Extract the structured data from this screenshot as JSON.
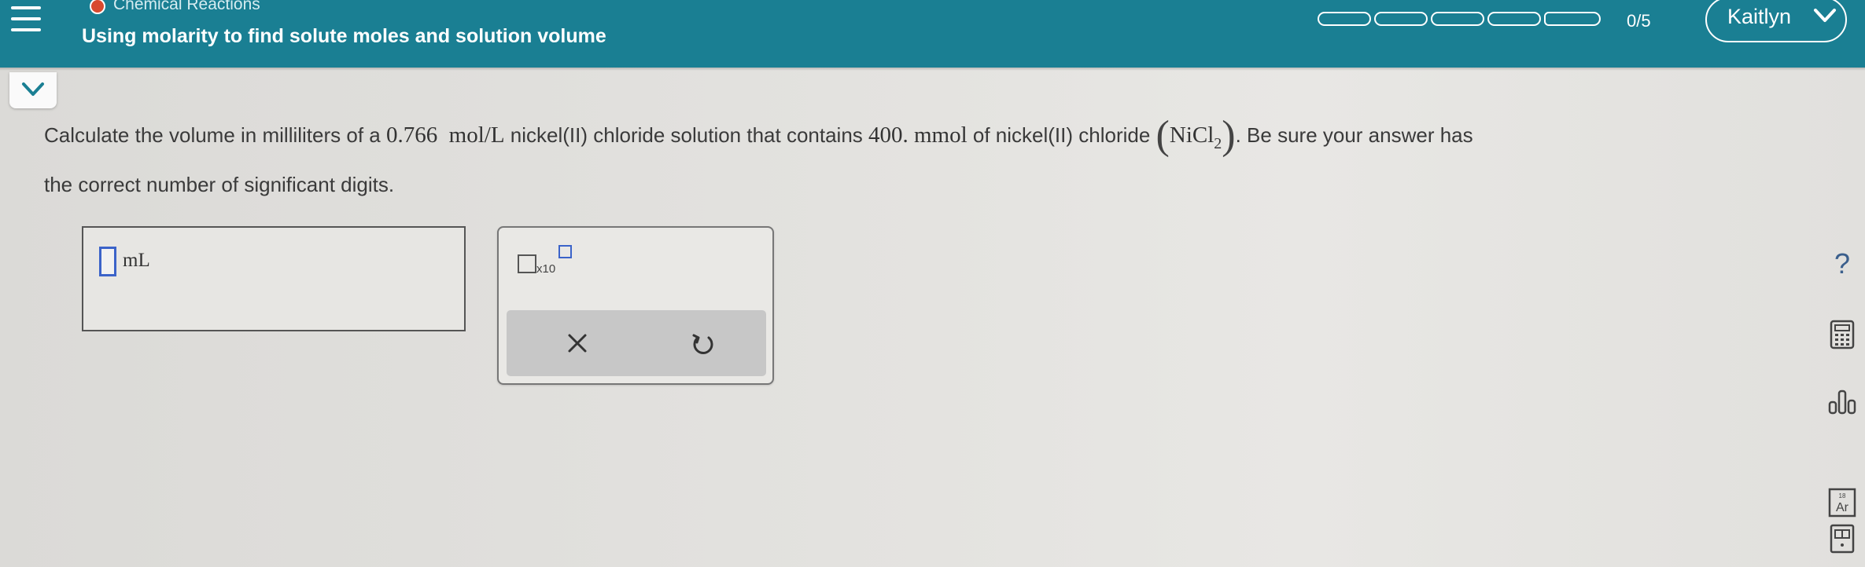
{
  "header": {
    "topic": "Chemical Reactions",
    "title": "Using molarity to find solute moles and solution volume",
    "progress": {
      "completed": 0,
      "total": 5,
      "label": "0/5"
    },
    "user_name": "Kaitlyn"
  },
  "question": {
    "line1": {
      "t1": "Calculate the volume in milliliters of a ",
      "m1": "0.766",
      "m2": "mol/L",
      "t2": " nickel(II) chloride solution that contains ",
      "m3": "400.",
      "m4": "mmol",
      "t3": " of nickel(II) chloride ",
      "formula_main": "NiCl",
      "formula_sub": "2",
      "t4": ". Be sure your answer has"
    },
    "line2": "the correct number of significant digits."
  },
  "answer": {
    "value": "",
    "unit": "mL"
  },
  "tools": {
    "x10_label": "x10"
  },
  "right_rail": {
    "help_label": "?",
    "periodic_number": "18",
    "periodic_symbol": "Ar"
  },
  "colors": {
    "header": "#1a7f93",
    "accent": "#3b63c9",
    "status_dot": "#d84a2f"
  },
  "icons": [
    "menu-icon",
    "chevron-down-icon",
    "times-icon",
    "undo-icon",
    "calculator-icon",
    "bar-chart-icon",
    "periodic-table-icon",
    "reference-icon"
  ]
}
